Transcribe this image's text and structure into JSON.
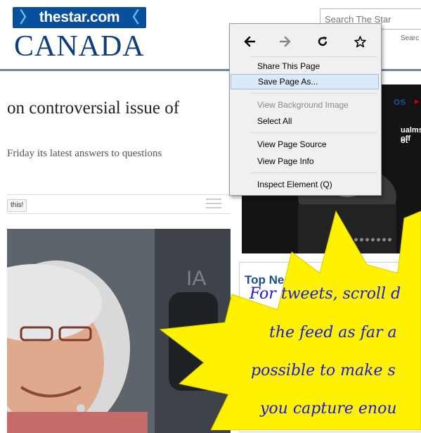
{
  "header": {
    "logo_prefix": "the",
    "logo_rest": "star.com",
    "logo_left_chevron": "〉",
    "logo_right_chevron": "〈",
    "section_title": "CANADA",
    "search_placeholder": "Search The Star",
    "search_button": "Searc"
  },
  "article": {
    "headline": "on controversial issue of",
    "subhead": "Friday its latest answers to questions",
    "share_button": "this!"
  },
  "right_column": {
    "video_heading": "os",
    "video_arrow": "▸",
    "video_caption_1": "ualms off",
    "video_caption_2": "ot",
    "top_news_heading": "Top Ne"
  },
  "context_menu": {
    "nav": {
      "back_icon": "arrow-left",
      "forward_icon": "arrow-right",
      "reload_icon": "reload",
      "bookmark_icon": "star"
    },
    "items": [
      {
        "label": "Share This Page",
        "enabled": true,
        "highlighted": false
      },
      {
        "label": "Save Page As...",
        "enabled": true,
        "highlighted": true
      },
      {
        "label": "View Background Image",
        "enabled": false,
        "highlighted": false
      },
      {
        "label": "Select All",
        "enabled": true,
        "highlighted": false
      },
      {
        "label": "View Page Source",
        "enabled": true,
        "highlighted": false
      },
      {
        "label": "View Page Info",
        "enabled": true,
        "highlighted": false
      },
      {
        "label": "Inspect Element (Q)",
        "enabled": true,
        "highlighted": false
      }
    ]
  },
  "callout": {
    "lines": [
      "For tweets, scroll d",
      "the feed as far a",
      "possible to make s",
      "you capture enou"
    ],
    "fill_color": "#fff200",
    "text_color": "#1a1adc"
  },
  "colors": {
    "brand_blue": "#0a4f9c",
    "canada_blue": "#0a3f7c",
    "menu_highlight": "#dce9f8"
  }
}
